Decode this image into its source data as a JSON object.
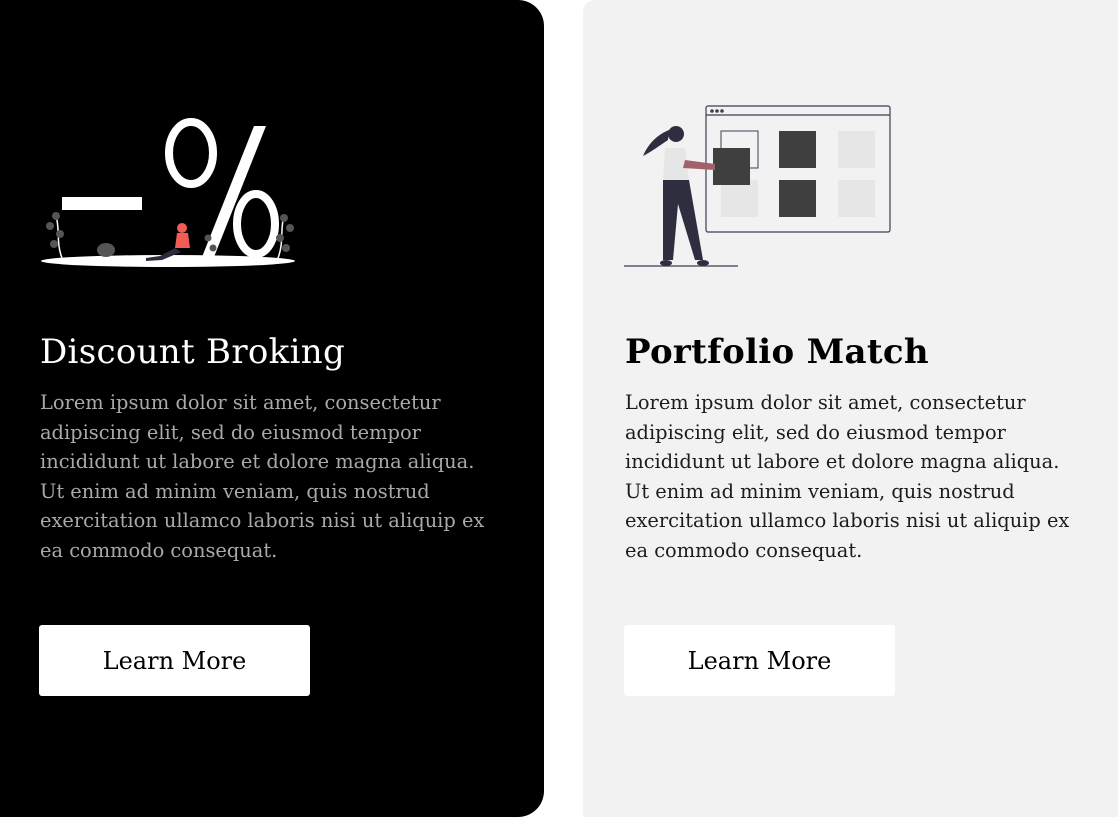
{
  "cards": [
    {
      "title": "Discount Broking",
      "description": "Lorem ipsum dolor sit amet, consectetur adipiscing elit, sed do eiusmod tempor incididunt ut labore et dolore magna aliqua. Ut enim ad minim veniam, quis nostrud exercitation ullamco laboris nisi ut aliquip ex ea commodo consequat.",
      "button_label": "Learn More",
      "illustration": "percent-sign-illustration",
      "theme": {
        "background": "#000000",
        "title_color": "#ffffff",
        "text_color": "#a9a9a9"
      }
    },
    {
      "title": "Portfolio Match",
      "description": "Lorem ipsum dolor sit amet, consectetur adipiscing elit, sed do eiusmod tempor incididunt ut labore et dolore magna aliqua. Ut enim ad minim veniam, quis nostrud exercitation ullamco laboris nisi ut aliquip ex ea commodo consequat.",
      "button_label": "Learn More",
      "illustration": "person-arranging-blocks-illustration",
      "theme": {
        "background": "#f2f2f2",
        "title_color": "#000000",
        "text_color": "#1c1c1c"
      }
    }
  ]
}
